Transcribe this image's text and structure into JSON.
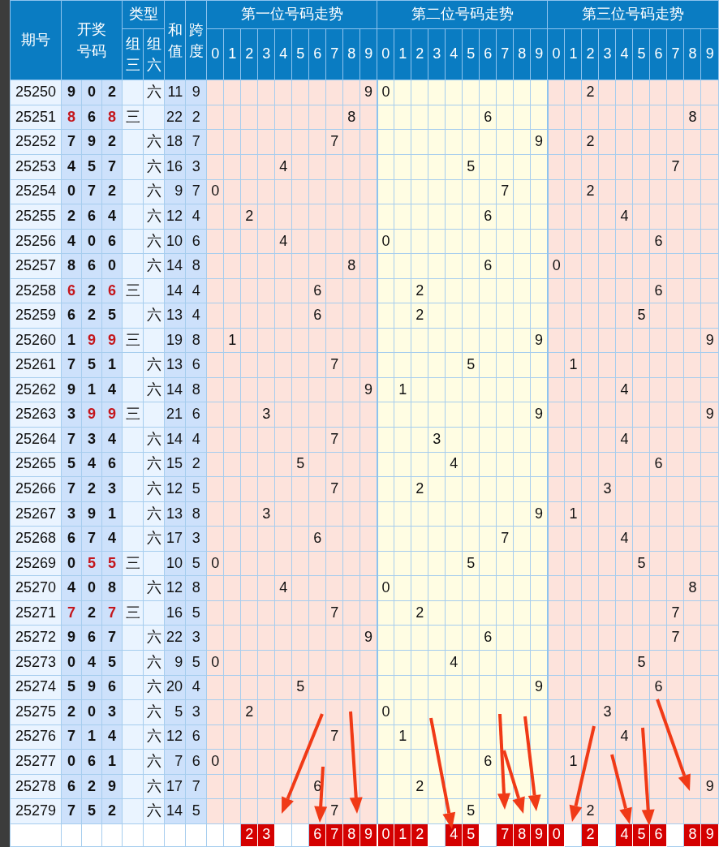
{
  "header": {
    "period": "期号",
    "draw": "开奖号码",
    "type": "类型",
    "type_cols": [
      {
        "kind": "zu3",
        "label": "组三"
      },
      {
        "kind": "zu6",
        "label": "组六"
      }
    ],
    "sum": "和值",
    "span": "跨度",
    "sections": [
      {
        "title": "第一位号码走势",
        "digits": [
          "0",
          "1",
          "2",
          "3",
          "4",
          "5",
          "6",
          "7",
          "8",
          "9"
        ]
      },
      {
        "title": "第二位号码走势",
        "digits": [
          "0",
          "1",
          "2",
          "3",
          "4",
          "5",
          "6",
          "7",
          "8",
          "9"
        ]
      },
      {
        "title": "第三位号码走势",
        "digits": [
          "0",
          "1",
          "2",
          "3",
          "4",
          "5",
          "6",
          "7",
          "8",
          "9"
        ]
      }
    ]
  },
  "rows": [
    {
      "period": "25250",
      "draw": [
        "9",
        "0",
        "2"
      ],
      "repeat": [
        false,
        false,
        false
      ],
      "type": {
        "kind": "zu6",
        "label": "六"
      },
      "sum": "11",
      "span": "9",
      "trend": [
        "9",
        "0",
        "2"
      ]
    },
    {
      "period": "25251",
      "draw": [
        "8",
        "6",
        "8"
      ],
      "repeat": [
        true,
        false,
        true
      ],
      "type": {
        "kind": "zu3",
        "label": "三"
      },
      "sum": "22",
      "span": "2",
      "trend": [
        "8",
        "6",
        "8"
      ]
    },
    {
      "period": "25252",
      "draw": [
        "7",
        "9",
        "2"
      ],
      "repeat": [
        false,
        false,
        false
      ],
      "type": {
        "kind": "zu6",
        "label": "六"
      },
      "sum": "18",
      "span": "7",
      "trend": [
        "7",
        "9",
        "2"
      ]
    },
    {
      "period": "25253",
      "draw": [
        "4",
        "5",
        "7"
      ],
      "repeat": [
        false,
        false,
        false
      ],
      "type": {
        "kind": "zu6",
        "label": "六"
      },
      "sum": "16",
      "span": "3",
      "trend": [
        "4",
        "5",
        "7"
      ]
    },
    {
      "period": "25254",
      "draw": [
        "0",
        "7",
        "2"
      ],
      "repeat": [
        false,
        false,
        false
      ],
      "type": {
        "kind": "zu6",
        "label": "六"
      },
      "sum": "9",
      "span": "7",
      "trend": [
        "0",
        "7",
        "2"
      ]
    },
    {
      "period": "25255",
      "draw": [
        "2",
        "6",
        "4"
      ],
      "repeat": [
        false,
        false,
        false
      ],
      "type": {
        "kind": "zu6",
        "label": "六"
      },
      "sum": "12",
      "span": "4",
      "trend": [
        "2",
        "6",
        "4"
      ]
    },
    {
      "period": "25256",
      "draw": [
        "4",
        "0",
        "6"
      ],
      "repeat": [
        false,
        false,
        false
      ],
      "type": {
        "kind": "zu6",
        "label": "六"
      },
      "sum": "10",
      "span": "6",
      "trend": [
        "4",
        "0",
        "6"
      ]
    },
    {
      "period": "25257",
      "draw": [
        "8",
        "6",
        "0"
      ],
      "repeat": [
        false,
        false,
        false
      ],
      "type": {
        "kind": "zu6",
        "label": "六"
      },
      "sum": "14",
      "span": "8",
      "trend": [
        "8",
        "6",
        "0"
      ]
    },
    {
      "period": "25258",
      "draw": [
        "6",
        "2",
        "6"
      ],
      "repeat": [
        true,
        false,
        true
      ],
      "type": {
        "kind": "zu3",
        "label": "三"
      },
      "sum": "14",
      "span": "4",
      "trend": [
        "6",
        "2",
        "6"
      ]
    },
    {
      "period": "25259",
      "draw": [
        "6",
        "2",
        "5"
      ],
      "repeat": [
        false,
        false,
        false
      ],
      "type": {
        "kind": "zu6",
        "label": "六"
      },
      "sum": "13",
      "span": "4",
      "trend": [
        "6",
        "2",
        "5"
      ]
    },
    {
      "period": "25260",
      "draw": [
        "1",
        "9",
        "9"
      ],
      "repeat": [
        false,
        true,
        true
      ],
      "type": {
        "kind": "zu3",
        "label": "三"
      },
      "sum": "19",
      "span": "8",
      "trend": [
        "1",
        "9",
        "9"
      ]
    },
    {
      "period": "25261",
      "draw": [
        "7",
        "5",
        "1"
      ],
      "repeat": [
        false,
        false,
        false
      ],
      "type": {
        "kind": "zu6",
        "label": "六"
      },
      "sum": "13",
      "span": "6",
      "trend": [
        "7",
        "5",
        "1"
      ]
    },
    {
      "period": "25262",
      "draw": [
        "9",
        "1",
        "4"
      ],
      "repeat": [
        false,
        false,
        false
      ],
      "type": {
        "kind": "zu6",
        "label": "六"
      },
      "sum": "14",
      "span": "8",
      "trend": [
        "9",
        "1",
        "4"
      ]
    },
    {
      "period": "25263",
      "draw": [
        "3",
        "9",
        "9"
      ],
      "repeat": [
        false,
        true,
        true
      ],
      "type": {
        "kind": "zu3",
        "label": "三"
      },
      "sum": "21",
      "span": "6",
      "trend": [
        "3",
        "9",
        "9"
      ]
    },
    {
      "period": "25264",
      "draw": [
        "7",
        "3",
        "4"
      ],
      "repeat": [
        false,
        false,
        false
      ],
      "type": {
        "kind": "zu6",
        "label": "六"
      },
      "sum": "14",
      "span": "4",
      "trend": [
        "7",
        "3",
        "4"
      ]
    },
    {
      "period": "25265",
      "draw": [
        "5",
        "4",
        "6"
      ],
      "repeat": [
        false,
        false,
        false
      ],
      "type": {
        "kind": "zu6",
        "label": "六"
      },
      "sum": "15",
      "span": "2",
      "trend": [
        "5",
        "4",
        "6"
      ]
    },
    {
      "period": "25266",
      "draw": [
        "7",
        "2",
        "3"
      ],
      "repeat": [
        false,
        false,
        false
      ],
      "type": {
        "kind": "zu6",
        "label": "六"
      },
      "sum": "12",
      "span": "5",
      "trend": [
        "7",
        "2",
        "3"
      ]
    },
    {
      "period": "25267",
      "draw": [
        "3",
        "9",
        "1"
      ],
      "repeat": [
        false,
        false,
        false
      ],
      "type": {
        "kind": "zu6",
        "label": "六"
      },
      "sum": "13",
      "span": "8",
      "trend": [
        "3",
        "9",
        "1"
      ]
    },
    {
      "period": "25268",
      "draw": [
        "6",
        "7",
        "4"
      ],
      "repeat": [
        false,
        false,
        false
      ],
      "type": {
        "kind": "zu6",
        "label": "六"
      },
      "sum": "17",
      "span": "3",
      "trend": [
        "6",
        "7",
        "4"
      ]
    },
    {
      "period": "25269",
      "draw": [
        "0",
        "5",
        "5"
      ],
      "repeat": [
        false,
        true,
        true
      ],
      "type": {
        "kind": "zu3",
        "label": "三"
      },
      "sum": "10",
      "span": "5",
      "trend": [
        "0",
        "5",
        "5"
      ]
    },
    {
      "period": "25270",
      "draw": [
        "4",
        "0",
        "8"
      ],
      "repeat": [
        false,
        false,
        false
      ],
      "type": {
        "kind": "zu6",
        "label": "六"
      },
      "sum": "12",
      "span": "8",
      "trend": [
        "4",
        "0",
        "8"
      ]
    },
    {
      "period": "25271",
      "draw": [
        "7",
        "2",
        "7"
      ],
      "repeat": [
        true,
        false,
        true
      ],
      "type": {
        "kind": "zu3",
        "label": "三"
      },
      "sum": "16",
      "span": "5",
      "trend": [
        "7",
        "2",
        "7"
      ]
    },
    {
      "period": "25272",
      "draw": [
        "9",
        "6",
        "7"
      ],
      "repeat": [
        false,
        false,
        false
      ],
      "type": {
        "kind": "zu6",
        "label": "六"
      },
      "sum": "22",
      "span": "3",
      "trend": [
        "9",
        "6",
        "7"
      ]
    },
    {
      "period": "25273",
      "draw": [
        "0",
        "4",
        "5"
      ],
      "repeat": [
        false,
        false,
        false
      ],
      "type": {
        "kind": "zu6",
        "label": "六"
      },
      "sum": "9",
      "span": "5",
      "trend": [
        "0",
        "4",
        "5"
      ]
    },
    {
      "period": "25274",
      "draw": [
        "5",
        "9",
        "6"
      ],
      "repeat": [
        false,
        false,
        false
      ],
      "type": {
        "kind": "zu6",
        "label": "六"
      },
      "sum": "20",
      "span": "4",
      "trend": [
        "5",
        "9",
        "6"
      ]
    },
    {
      "period": "25275",
      "draw": [
        "2",
        "0",
        "3"
      ],
      "repeat": [
        false,
        false,
        false
      ],
      "type": {
        "kind": "zu6",
        "label": "六"
      },
      "sum": "5",
      "span": "3",
      "trend": [
        "2",
        "0",
        "3"
      ]
    },
    {
      "period": "25276",
      "draw": [
        "7",
        "1",
        "4"
      ],
      "repeat": [
        false,
        false,
        false
      ],
      "type": {
        "kind": "zu6",
        "label": "六"
      },
      "sum": "12",
      "span": "6",
      "trend": [
        "7",
        "1",
        "4"
      ]
    },
    {
      "period": "25277",
      "draw": [
        "0",
        "6",
        "1"
      ],
      "repeat": [
        false,
        false,
        false
      ],
      "type": {
        "kind": "zu6",
        "label": "六"
      },
      "sum": "7",
      "span": "6",
      "trend": [
        "0",
        "6",
        "1"
      ]
    },
    {
      "period": "25278",
      "draw": [
        "6",
        "2",
        "9"
      ],
      "repeat": [
        false,
        false,
        false
      ],
      "type": {
        "kind": "zu6",
        "label": "六"
      },
      "sum": "17",
      "span": "7",
      "trend": [
        "6",
        "2",
        "9"
      ]
    },
    {
      "period": "25279",
      "draw": [
        "7",
        "5",
        "2"
      ],
      "repeat": [
        false,
        false,
        false
      ],
      "type": {
        "kind": "zu6",
        "label": "六"
      },
      "sum": "14",
      "span": "5",
      "trend": [
        "7",
        "5",
        "2"
      ]
    }
  ],
  "footer": [
    [
      "2",
      "3",
      "6",
      "7",
      "8",
      "9"
    ],
    [
      "0",
      "1",
      "2",
      "4",
      "5",
      "7",
      "8",
      "9"
    ],
    [
      "0",
      "2",
      "4",
      "5",
      "6",
      "8",
      "9"
    ]
  ]
}
